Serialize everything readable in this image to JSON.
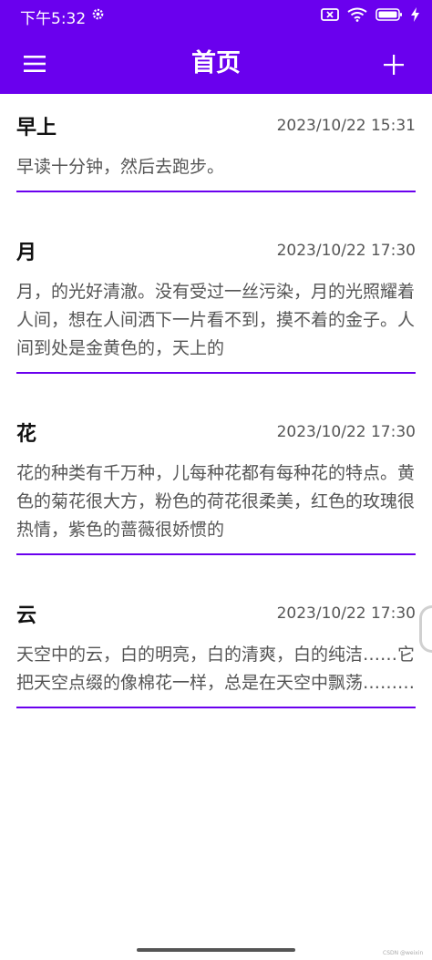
{
  "status_bar": {
    "time": "下午5:32",
    "icons": [
      "gear-icon",
      "sim-x-icon",
      "wifi-icon",
      "battery-icon",
      "charging-icon"
    ]
  },
  "header": {
    "title": "首页",
    "menu_icon": "hamburger-menu-icon",
    "add_icon": "plus-icon"
  },
  "notes": [
    {
      "title": "早上",
      "time": "2023/10/22 15:31",
      "body": "早读十分钟，然后去跑步。"
    },
    {
      "title": "月",
      "time": "2023/10/22 17:30",
      "body": "月，的光好清澈。没有受过一丝污染，月的光照耀着人间，想在人间洒下一片看不到，摸不着的金子。人间到处是金黄色的，天上的"
    },
    {
      "title": "花",
      "time": "2023/10/22 17:30",
      "body": "花的种类有千万种，儿每种花都有每种花的特点。黄色的菊花很大方，粉色的荷花很柔美，红色的玫瑰很热情，紫色的蔷薇很娇惯的"
    },
    {
      "title": "云",
      "time": "2023/10/22 17:30",
      "body": "天空中的云，白的明亮，白的清爽，白的纯洁……它把天空点缀的像棉花一样，总是在天空中飘荡………"
    }
  ],
  "watermark": "CSDN @weixin",
  "colors": {
    "primary": "#6a00ee",
    "divider": "#6a00ee",
    "title_text": "#111111",
    "secondary_text": "#555555"
  }
}
